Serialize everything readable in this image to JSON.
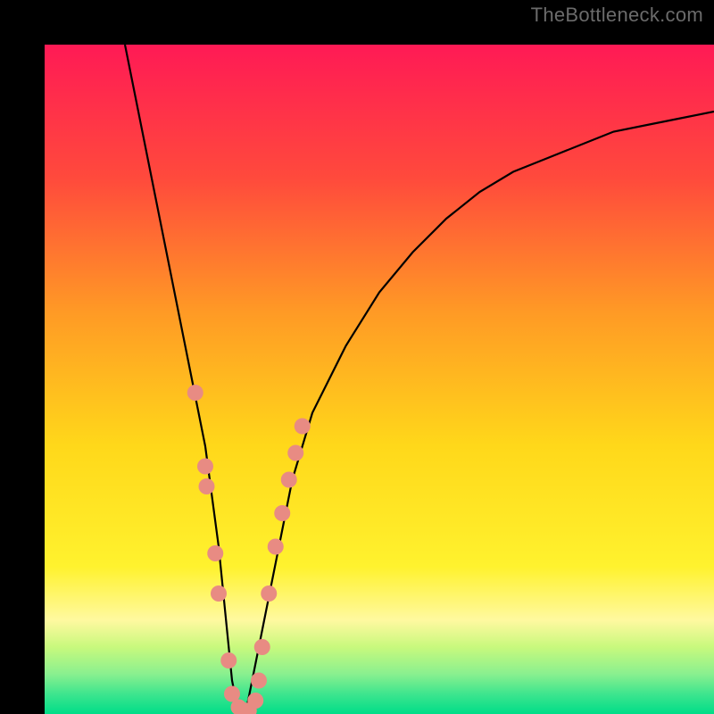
{
  "watermark": "TheBottleneck.com",
  "chart_data": {
    "type": "line",
    "title": "",
    "xlabel": "",
    "ylabel": "",
    "xlim": [
      0,
      100
    ],
    "ylim": [
      0,
      100
    ],
    "grid": false,
    "legend": false,
    "background": {
      "type": "vertical-gradient",
      "stops": [
        {
          "pos": 0.0,
          "color": "#ff1a55"
        },
        {
          "pos": 0.2,
          "color": "#ff4a3c"
        },
        {
          "pos": 0.4,
          "color": "#ff9a25"
        },
        {
          "pos": 0.6,
          "color": "#ffd81a"
        },
        {
          "pos": 0.78,
          "color": "#fff22e"
        },
        {
          "pos": 0.86,
          "color": "#fff9a0"
        },
        {
          "pos": 0.9,
          "color": "#c8f97d"
        },
        {
          "pos": 0.94,
          "color": "#8af08f"
        },
        {
          "pos": 0.97,
          "color": "#3ee58e"
        },
        {
          "pos": 1.0,
          "color": "#00dd88"
        }
      ]
    },
    "series": [
      {
        "name": "bottleneck-curve",
        "color": "#000000",
        "x": [
          12,
          14,
          16,
          18,
          20,
          22,
          24,
          26,
          27,
          28,
          29,
          30,
          31,
          33,
          35,
          37,
          40,
          45,
          50,
          55,
          60,
          65,
          70,
          75,
          80,
          85,
          90,
          95,
          100
        ],
        "y": [
          100,
          90,
          80,
          70,
          60,
          50,
          40,
          25,
          15,
          5,
          0,
          0,
          5,
          15,
          25,
          35,
          45,
          55,
          63,
          69,
          74,
          78,
          81,
          83,
          85,
          87,
          88,
          89,
          90
        ]
      }
    ],
    "markers": [
      {
        "name": "gpu-point",
        "color": "#e88b83",
        "x": 22.5,
        "y": 48
      },
      {
        "name": "gpu-point",
        "color": "#e88b83",
        "x": 24.0,
        "y": 37
      },
      {
        "name": "gpu-point",
        "color": "#e88b83",
        "x": 24.2,
        "y": 34
      },
      {
        "name": "gpu-point",
        "color": "#e88b83",
        "x": 25.5,
        "y": 24
      },
      {
        "name": "gpu-point",
        "color": "#e88b83",
        "x": 26.0,
        "y": 18
      },
      {
        "name": "gpu-point",
        "color": "#e88b83",
        "x": 27.5,
        "y": 8
      },
      {
        "name": "gpu-point",
        "color": "#e88b83",
        "x": 28.0,
        "y": 3
      },
      {
        "name": "gpu-point",
        "color": "#e88b83",
        "x": 29.0,
        "y": 1
      },
      {
        "name": "gpu-point",
        "color": "#e88b83",
        "x": 30.0,
        "y": 0.5
      },
      {
        "name": "gpu-point",
        "color": "#e88b83",
        "x": 30.5,
        "y": 0.5
      },
      {
        "name": "gpu-point",
        "color": "#e88b83",
        "x": 31.5,
        "y": 2
      },
      {
        "name": "gpu-point",
        "color": "#e88b83",
        "x": 32.0,
        "y": 5
      },
      {
        "name": "gpu-point",
        "color": "#e88b83",
        "x": 32.5,
        "y": 10
      },
      {
        "name": "gpu-point",
        "color": "#e88b83",
        "x": 33.5,
        "y": 18
      },
      {
        "name": "gpu-point",
        "color": "#e88b83",
        "x": 34.5,
        "y": 25
      },
      {
        "name": "gpu-point",
        "color": "#e88b83",
        "x": 35.5,
        "y": 30
      },
      {
        "name": "gpu-point",
        "color": "#e88b83",
        "x": 36.5,
        "y": 35
      },
      {
        "name": "gpu-point",
        "color": "#e88b83",
        "x": 37.5,
        "y": 39
      },
      {
        "name": "gpu-point",
        "color": "#e88b83",
        "x": 38.5,
        "y": 43
      }
    ]
  }
}
